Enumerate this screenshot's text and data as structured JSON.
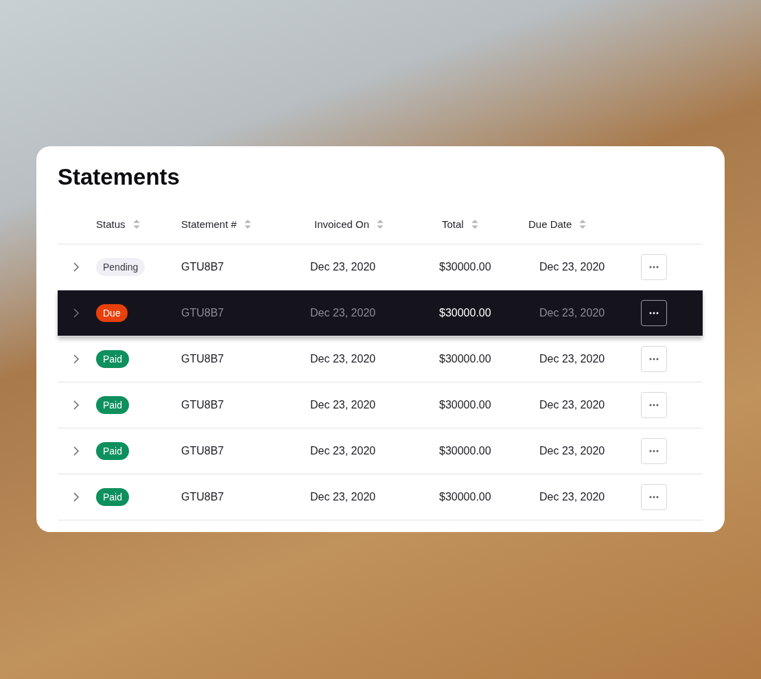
{
  "card": {
    "title": "Statements"
  },
  "table": {
    "columns": [
      "Status",
      "Statement #",
      "Invoiced On",
      "Total",
      "Due Date"
    ],
    "rows": [
      {
        "status": "Pending",
        "color": "#f1eff6",
        "statement": "GTU8B7",
        "invoiced_on": "Dec 23, 2020",
        "total": "$30000.00",
        "due_date": "Dec 23, 2020",
        "selected": false
      },
      {
        "status": "Due",
        "color": "#e8400c",
        "statement": "GTU8B7",
        "invoiced_on": "Dec 23, 2020",
        "total": "$30000.00",
        "due_date": "Dec 23, 2020",
        "selected": true
      },
      {
        "status": "Paid",
        "color": "#0e8f5e",
        "statement": "GTU8B7",
        "invoiced_on": "Dec 23, 2020",
        "total": "$30000.00",
        "due_date": "Dec 23, 2020",
        "selected": false
      },
      {
        "status": "Paid",
        "color": "#0e8f5e",
        "statement": "GTU8B7",
        "invoiced_on": "Dec 23, 2020",
        "total": "$30000.00",
        "due_date": "Dec 23, 2020",
        "selected": false
      },
      {
        "status": "Paid",
        "color": "#0e8f5e",
        "statement": "GTU8B7",
        "invoiced_on": "Dec 23, 2020",
        "total": "$30000.00",
        "due_date": "Dec 23, 2020",
        "selected": false
      },
      {
        "status": "Paid",
        "color": "#0e8f5e",
        "statement": "GTU8B7",
        "invoiced_on": "Dec 23, 2020",
        "total": "$30000.00",
        "due_date": "Dec 23, 2020",
        "selected": false
      }
    ]
  }
}
